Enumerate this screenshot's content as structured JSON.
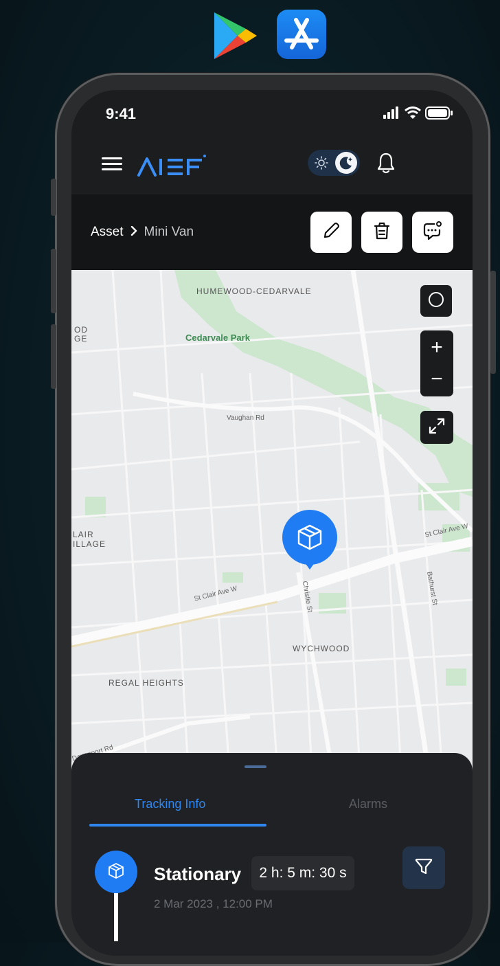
{
  "app": {
    "logo_text": "AIEF"
  },
  "status_bar": {
    "time": "9:41"
  },
  "breadcrumb": {
    "root": "Asset",
    "current": "Mini Van"
  },
  "map": {
    "labels": {
      "humewood": "HUMEWOOD-CEDARVALE",
      "cedarvale_park": "Cedarvale Park",
      "vaughan_rd": "Vaughan Rd",
      "st_clair_w": "St Clair Ave W",
      "st_clair_e": "St Clair Ave W",
      "christie": "Christie St",
      "bathurst": "Bathurst St",
      "wychwood": "WYCHWOOD",
      "regal_heights": "REGAL HEIGHTS",
      "od_ge_top": "OD",
      "od_ge_bottom": "GE",
      "lair": "LAIR",
      "illage": "ILLAGE",
      "davenport": "Davenport Rd"
    },
    "controls": {
      "zoom_in": "+",
      "zoom_out": "−"
    }
  },
  "bottom_sheet": {
    "tabs": [
      {
        "label": "Tracking Info",
        "active": true
      },
      {
        "label": "Alarms",
        "active": false
      }
    ],
    "event": {
      "status": "Stationary",
      "duration": "2 h: 5 m: 30 s",
      "date": "2 Mar 2023 , 12:00 PM"
    }
  },
  "colors": {
    "accent": "#1f7cf2",
    "background": "#0a1c23",
    "park_green": "#cde7cf"
  },
  "icons": [
    "menu-icon",
    "sun-icon",
    "moon-icon",
    "bell-icon",
    "pencil-icon",
    "trash-icon",
    "chat-icon",
    "circle-icon",
    "expand-icon",
    "box-icon",
    "filter-icon",
    "signal-icon",
    "wifi-icon",
    "battery-icon"
  ]
}
